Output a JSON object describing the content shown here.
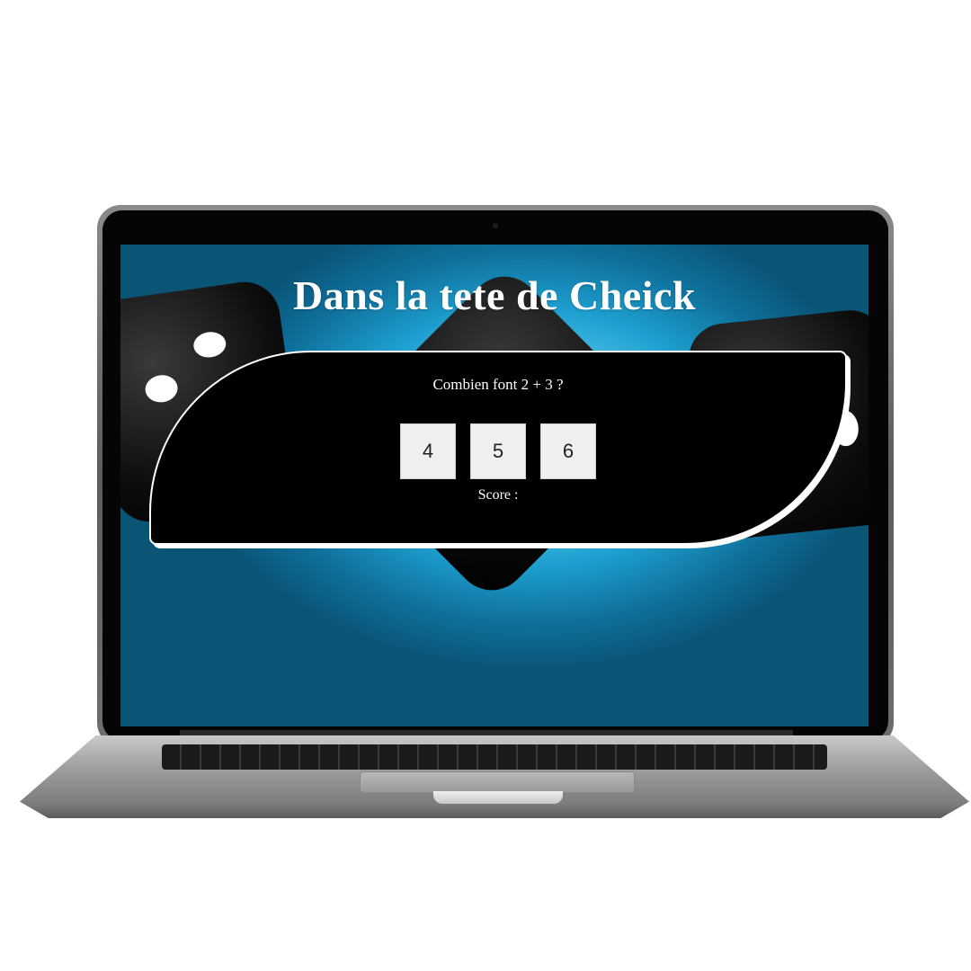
{
  "app": {
    "title": "Dans la tete de Cheick"
  },
  "quiz": {
    "question": "Combien font 2 + 3 ?",
    "answers": [
      "4",
      "5",
      "6"
    ],
    "score_label": "Score :"
  },
  "colors": {
    "panel_background": "#000000",
    "panel_border": "#ffffff",
    "title_text": "#ffffff",
    "answer_button_bg": "#efefef",
    "screen_glow": "#1d9fcf"
  }
}
